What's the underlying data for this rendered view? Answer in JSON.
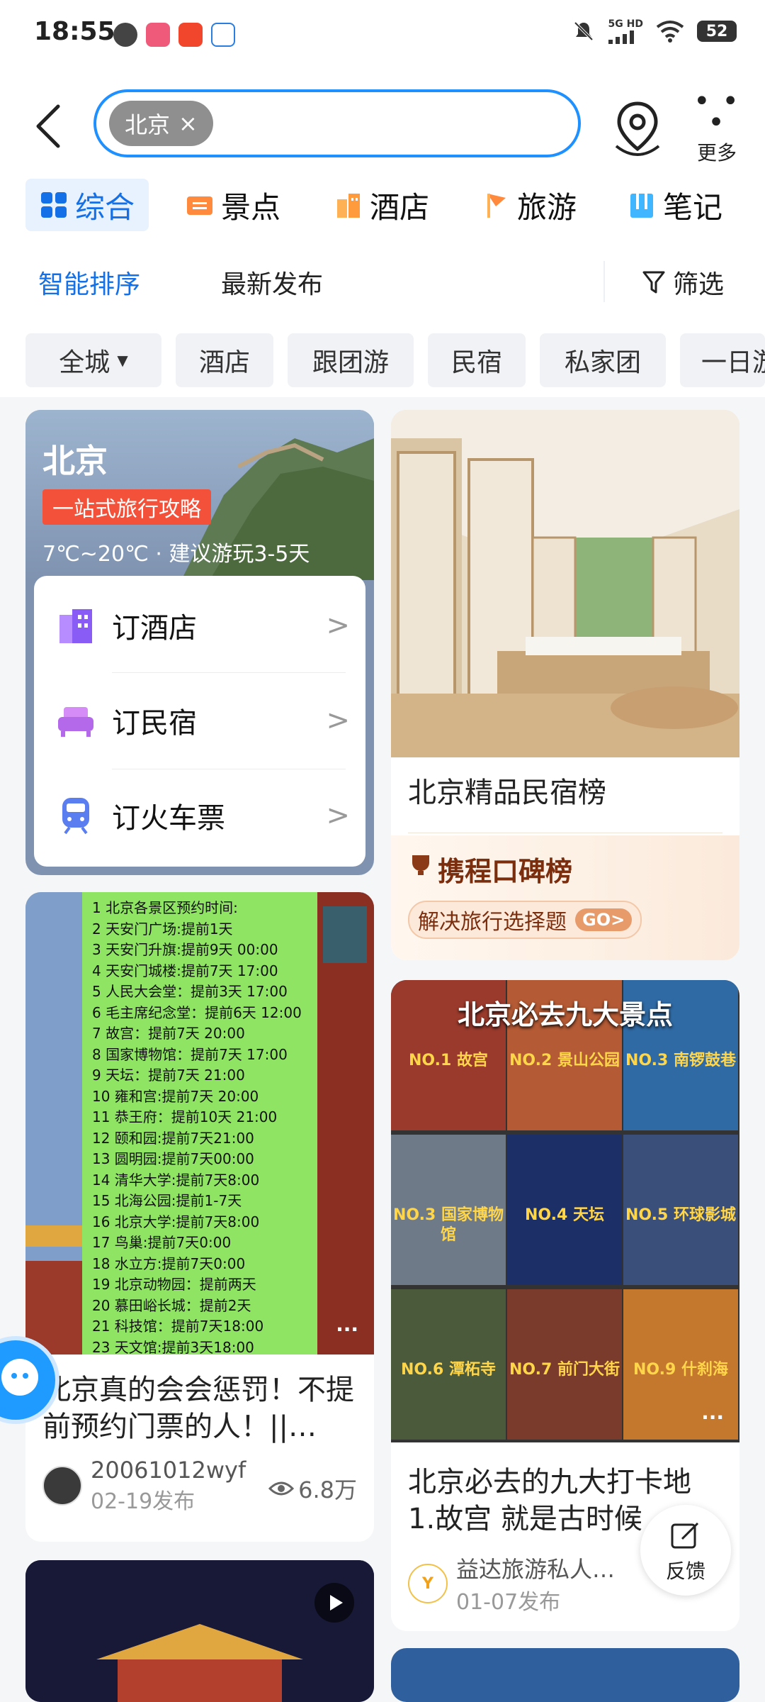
{
  "status_bar": {
    "time": "18:55",
    "network": "5G HD",
    "battery": "52"
  },
  "search": {
    "chip_text": "北京",
    "chip_clear": "×"
  },
  "header": {
    "more_label": "更多"
  },
  "category_tabs": [
    {
      "label": "综合",
      "icon": "grid-icon",
      "active": true
    },
    {
      "label": "景点",
      "icon": "ticket-icon"
    },
    {
      "label": "酒店",
      "icon": "hotel-icon"
    },
    {
      "label": "旅游",
      "icon": "flag-icon"
    },
    {
      "label": "笔记",
      "icon": "note-icon"
    }
  ],
  "sort": {
    "smart": "智能排序",
    "latest": "最新发布",
    "filter": "筛选"
  },
  "filter_chips": [
    "全城",
    "酒店",
    "跟团游",
    "民宿",
    "私家团",
    "一日游"
  ],
  "guide_card": {
    "title": "北京",
    "badge": "一站式旅行攻略",
    "weather": "7℃~20℃ · 建议游玩3-5天",
    "items": [
      {
        "label": "订酒店",
        "icon": "hotel-building-icon"
      },
      {
        "label": "订民宿",
        "icon": "sofa-icon"
      },
      {
        "label": "订火车票",
        "icon": "train-icon"
      }
    ],
    "chevron": ">"
  },
  "homestay_card": {
    "title": "北京精品民宿榜",
    "brand": "携程口碑榜",
    "slogan": "解决旅行选择题",
    "go": "GO>"
  },
  "note_card_1": {
    "title": "北京真的会会惩罚！不提前预约门票的人！||…",
    "author": "20061012wyf",
    "date": "02-19发布",
    "views": "6.8万",
    "more": "···",
    "rules": [
      "1 北京各景区预约时间:",
      "2 天安门广场:提前1天",
      "3 天安门升旗:提前9天 00:00",
      "4 天安门城楼:提前7天 17:00",
      "5 人民大会堂：提前3天 17:00",
      "6 毛主席纪念堂：提前6天 12:00",
      "7 故宫：提前7天 20:00",
      "8 国家博物馆：提前7天 17:00",
      "9 天坛：提前7天 21:00",
      "10 雍和宫:提前7天 20:00",
      "11 恭王府：提前10天 21:00",
      "12 颐和园:提前7天21:00",
      "13 圆明园:提前7天00:00",
      "14 清华大学:提前7天8:00",
      "15 北海公园:提前1-7天",
      "16 北京大学:提前7天8:00",
      "17 鸟巢:提前7天0:00",
      "18 水立方:提前7天0:00",
      "19 北京动物园：提前两天",
      "20 慕田峪长城：提前2天",
      "21 科技馆：提前7天18:00",
      "23 天文馆:提前3天18:00"
    ]
  },
  "note_card_2": {
    "image_title": "北京必去九大景点",
    "spots": [
      "NO.1 故宫",
      "NO.2 景山公园",
      "NO.3 南锣鼓巷",
      "NO.3 国家博物馆",
      "NO.4 天坛",
      "NO.5 环球影城",
      "NO.6 潭柘寺",
      "NO.7 前门大街",
      "NO.9 什刹海"
    ],
    "title": "北京必去的九大打卡地 1.故宫 就是古时候",
    "author": "益达旅游私人…",
    "date": "01-07发布",
    "more": "···"
  },
  "feedback": {
    "label": "反馈"
  }
}
